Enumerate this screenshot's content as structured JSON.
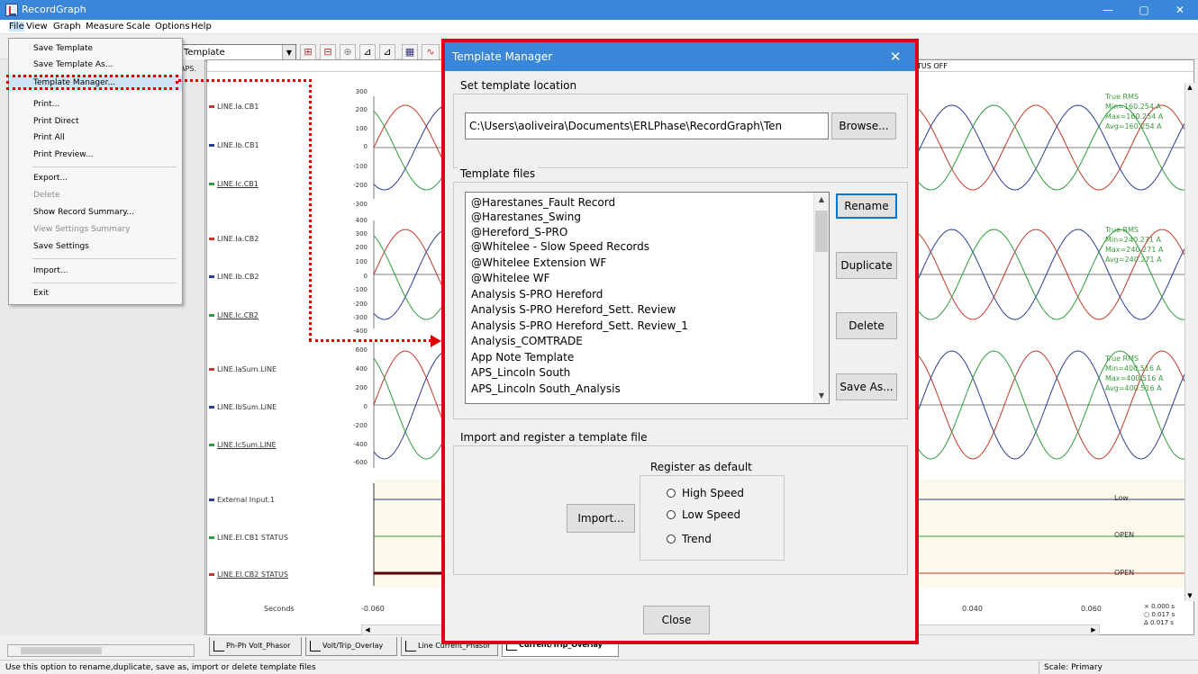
{
  "window": {
    "title": "RecordGraph",
    "buttons": [
      "—",
      "▢",
      "✕"
    ]
  },
  "menubar": [
    "File",
    "View",
    "Graph",
    "Measure",
    "Scale",
    "Options",
    "Help"
  ],
  "toolbar": {
    "template_combo": "Template"
  },
  "left_strip": {
    "aps_label": "APS."
  },
  "file_menu": {
    "items": [
      {
        "label": "Save Template",
        "disabled": false
      },
      {
        "label": "Save Template As...",
        "disabled": false
      },
      {
        "label": "Template Manager...",
        "disabled": false,
        "highlighted": true
      },
      {
        "label": "Print...",
        "disabled": false
      },
      {
        "label": "Print Direct",
        "disabled": false
      },
      {
        "label": "Print All",
        "disabled": false
      },
      {
        "label": "Print Preview...",
        "disabled": false
      },
      {
        "label": "Export...",
        "disabled": false
      },
      {
        "label": "Delete",
        "disabled": true
      },
      {
        "label": "Show Record Summary...",
        "disabled": false
      },
      {
        "label": "View Settings Summary",
        "disabled": true
      },
      {
        "label": "Save Settings",
        "disabled": false
      },
      {
        "label": "Import...",
        "disabled": false
      },
      {
        "label": "Exit",
        "disabled": false
      }
    ]
  },
  "graph": {
    "header_right": "TUS OFF",
    "channels": [
      {
        "label": "LINE.Ia.CB1",
        "color": "#c0392b"
      },
      {
        "label": "LINE.Ib.CB1",
        "color": "#2c3e90"
      },
      {
        "label": "LINE.Ic.CB1",
        "color": "#2e9b3e"
      },
      {
        "label": "LINE.Ia.CB2",
        "color": "#c0392b"
      },
      {
        "label": "LINE.Ib.CB2",
        "color": "#2c3e90"
      },
      {
        "label": "LINE.Ic.CB2",
        "color": "#2e9b3e"
      },
      {
        "label": "LINE.IaSum.LINE",
        "color": "#c0392b"
      },
      {
        "label": "LINE.IbSum.LINE",
        "color": "#2c3e90"
      },
      {
        "label": "LINE.IcSum.LINE",
        "color": "#2e9b3e"
      },
      {
        "label": "External Input.1",
        "color": "#2c3e90"
      },
      {
        "label": "LINE.El.CB1 STATUS",
        "color": "#2e9b3e"
      },
      {
        "label": "LINE.El.CB2 STATUS",
        "color": "#c0392b"
      }
    ],
    "axes": [
      {
        "ticks": [
          "300",
          "200",
          "100",
          "0",
          "-100",
          "-200",
          "-300"
        ]
      },
      {
        "ticks": [
          "400",
          "300",
          "200",
          "100",
          "0",
          "-100",
          "-200",
          "-300",
          "-400"
        ]
      },
      {
        "ticks": [
          "600",
          "400",
          "200",
          "0",
          "-200",
          "-400",
          "-600"
        ]
      }
    ],
    "stats": [
      {
        "title": "True RMS",
        "min": "Min=160.254 A",
        "max": "Max=160.254 A",
        "avg": "Avg=160.254 A"
      },
      {
        "title": "True RMS",
        "min": "Min=240.271 A",
        "max": "Max=240.271 A",
        "avg": "Avg=240.271 A"
      },
      {
        "title": "True RMS",
        "min": "Min=400.516 A",
        "max": "Max=400.516 A",
        "avg": "Avg=400.516 A"
      }
    ],
    "digital_states": [
      "Low",
      "OPEN",
      "OPEN"
    ],
    "x_axis": {
      "label": "Seconds",
      "ticks": [
        "-0.060",
        "0.040",
        "0.060"
      ]
    },
    "cursor_info": [
      "× 0.000 s",
      "○ 0.017 s",
      "Δ 0.017 s"
    ]
  },
  "tabs": [
    "Ph-Ph Volt_Phasor",
    "Volt/Trip_Overlay",
    "Line Current_Phasor",
    "Current/Trip_Overlay"
  ],
  "status_bar": {
    "message": "Use this option to rename,duplicate, save as, import  or delete template files",
    "scale": "Scale: Primary"
  },
  "dialog": {
    "title": "Template Manager",
    "location_group": "Set template location",
    "path": "C:\\Users\\aoliveira\\Documents\\ERLPhase\\RecordGraph\\Ten",
    "browse": "Browse...",
    "files_group": "Template files",
    "files": [
      "@Harestanes_Fault Record",
      "@Harestanes_Swing",
      "@Hereford_S-PRO",
      "@Whitelee - Slow Speed Records",
      "@Whitelee Extension WF",
      "@Whitelee WF",
      "Analysis S-PRO Hereford",
      "Analysis S-PRO Hereford_Sett. Review",
      "Analysis S-PRO Hereford_Sett. Review_1",
      "Analysis_COMTRADE",
      "App Note Template",
      "APS_Lincoln South",
      "APS_Lincoln South_Analysis"
    ],
    "rename": "Rename",
    "duplicate": "Duplicate",
    "delete": "Delete",
    "save_as": "Save As...",
    "import_group": "Import and register a template file",
    "register_group": "Register as default",
    "import": "Import...",
    "radios": [
      "High Speed",
      "Low Speed",
      "Trend"
    ],
    "close": "Close"
  }
}
